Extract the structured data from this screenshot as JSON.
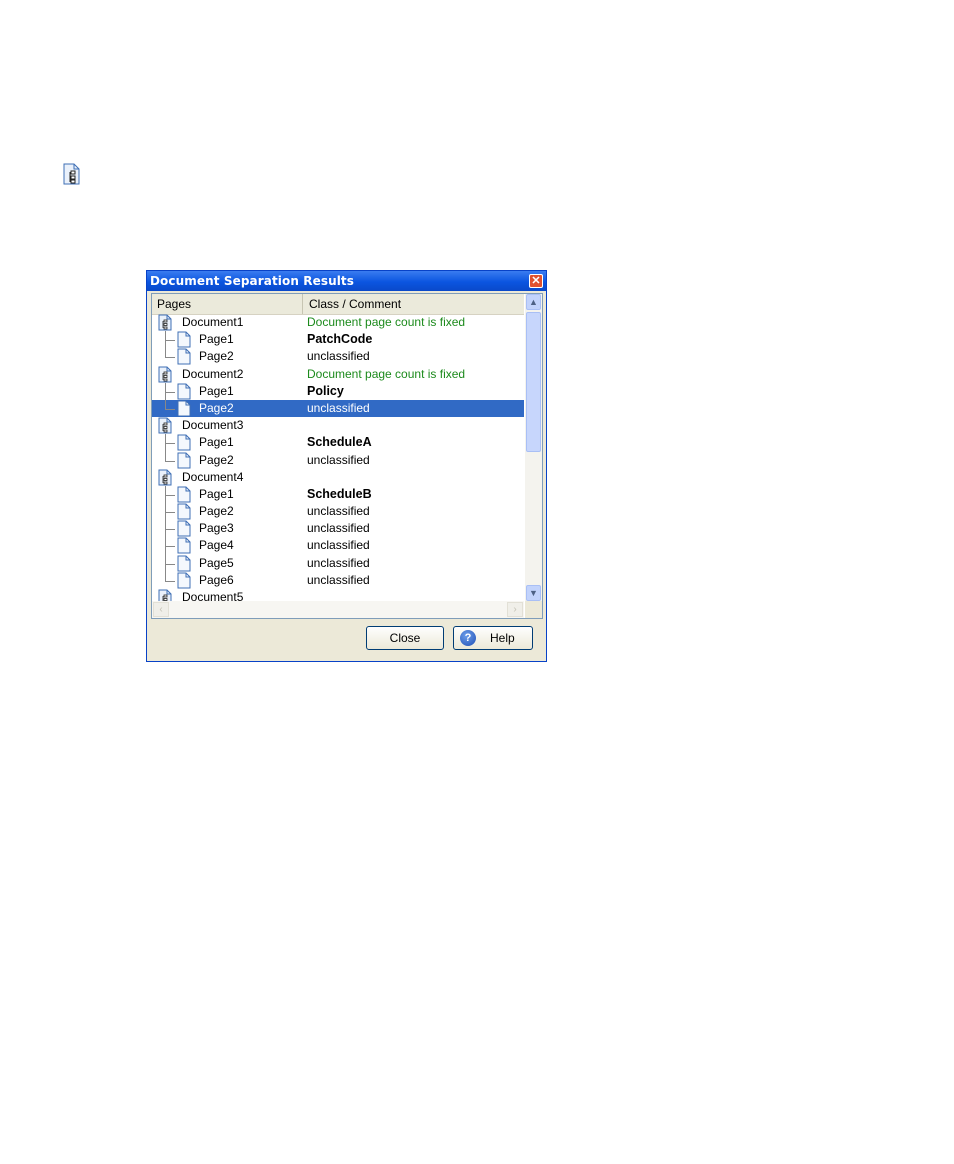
{
  "dialog": {
    "title": "Document Separation Results",
    "close_glyph": "✕",
    "columns": [
      "Pages",
      "Class / Comment"
    ],
    "rows": [
      {
        "kind": "doc",
        "label": "Document1",
        "comment": "Document page count is fixed",
        "style": "green"
      },
      {
        "kind": "page",
        "label": "Page1",
        "comment": "PatchCode",
        "style": "bold"
      },
      {
        "kind": "page",
        "label": "Page2",
        "comment": "unclassified",
        "style": "normal",
        "last": true
      },
      {
        "kind": "doc",
        "label": "Document2",
        "comment": "Document page count is fixed",
        "style": "green"
      },
      {
        "kind": "page",
        "label": "Page1",
        "comment": "Policy",
        "style": "bold"
      },
      {
        "kind": "page",
        "label": "Page2",
        "comment": "unclassified",
        "style": "normal",
        "last": true,
        "selected": true
      },
      {
        "kind": "doc",
        "label": "Document3",
        "comment": "",
        "style": "normal"
      },
      {
        "kind": "page",
        "label": "Page1",
        "comment": "ScheduleA",
        "style": "bold"
      },
      {
        "kind": "page",
        "label": "Page2",
        "comment": "unclassified",
        "style": "normal",
        "last": true
      },
      {
        "kind": "doc",
        "label": "Document4",
        "comment": "",
        "style": "normal"
      },
      {
        "kind": "page",
        "label": "Page1",
        "comment": "ScheduleB",
        "style": "bold"
      },
      {
        "kind": "page",
        "label": "Page2",
        "comment": "unclassified",
        "style": "normal"
      },
      {
        "kind": "page",
        "label": "Page3",
        "comment": "unclassified",
        "style": "normal"
      },
      {
        "kind": "page",
        "label": "Page4",
        "comment": "unclassified",
        "style": "normal"
      },
      {
        "kind": "page",
        "label": "Page5",
        "comment": "unclassified",
        "style": "normal"
      },
      {
        "kind": "page",
        "label": "Page6",
        "comment": "unclassified",
        "style": "normal",
        "last": true
      },
      {
        "kind": "doc",
        "label": "Document5",
        "comment": "",
        "style": "normal"
      }
    ],
    "buttons": {
      "close": "Close",
      "help": "Help"
    }
  },
  "icons": {
    "top": "document-tree-icon",
    "doc": "document-tree-icon",
    "page": "page-icon",
    "help": "help-icon"
  },
  "colors": {
    "selection": "#316ac5",
    "comment_green": "#1c8a1c",
    "titlebar": "#0b55e0"
  }
}
